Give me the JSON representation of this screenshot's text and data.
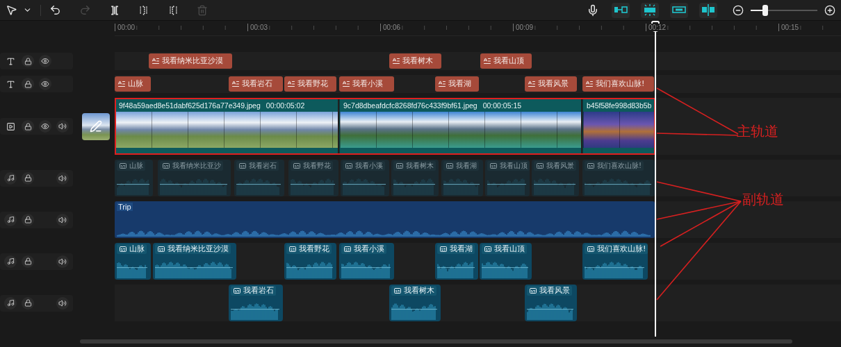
{
  "toolbar": {
    "left_tools": [
      {
        "kind": "select",
        "disabled": false
      },
      {
        "kind": "caret",
        "disabled": false
      },
      {
        "kind": "undo",
        "disabled": false
      },
      {
        "kind": "redo",
        "disabled": true
      },
      {
        "kind": "split",
        "disabled": false
      },
      {
        "kind": "trim_start",
        "disabled": false
      },
      {
        "kind": "trim_end",
        "disabled": false
      },
      {
        "kind": "delete",
        "disabled": true
      }
    ],
    "right_tools": [
      {
        "kind": "mic",
        "disabled": false
      },
      {
        "kind": "snap_link",
        "disabled": false
      },
      {
        "kind": "snap_magnet",
        "disabled": false
      },
      {
        "kind": "link",
        "disabled": false
      },
      {
        "kind": "preview_split",
        "disabled": false
      }
    ],
    "zoom": {
      "level": 0.22
    }
  },
  "ruler": {
    "marks": [
      "00:00",
      "00:03",
      "00:06",
      "00:09",
      "00:12",
      "00:15"
    ]
  },
  "tracks": [
    {
      "kind": "text",
      "clips": [
        {
          "label": "我看纳米比亚沙漠"
        },
        {
          "label": "我看树木"
        },
        {
          "label": "我看山顶"
        }
      ]
    },
    {
      "kind": "text",
      "clips": [
        {
          "label": "山脉"
        },
        {
          "label": "我看岩石"
        },
        {
          "label": "我看野花"
        },
        {
          "label": "我看小溪"
        },
        {
          "label": "我看湖"
        },
        {
          "label": "我看风景"
        },
        {
          "label": "我们喜欢山脉!"
        }
      ]
    },
    {
      "kind": "video",
      "highlighted": true,
      "clips": [
        {
          "name": "9f48a59aed8e51dabf625d176a77e349.jpeg",
          "duration": "00:00:05:02"
        },
        {
          "name": "9c7d8dbeafdcfc8268fd76c433f9bf61.jpeg",
          "duration": "00:00:05:15"
        },
        {
          "name": "b45f58fe998d83b5b"
        }
      ]
    },
    {
      "kind": "audio",
      "dimmed": true,
      "clips": [
        {
          "label": "山脉"
        },
        {
          "label": "我看纳米比亚沙"
        },
        {
          "label": "我看岩石"
        },
        {
          "label": "我看野花"
        },
        {
          "label": "我看小溪"
        },
        {
          "label": "我看树木"
        },
        {
          "label": "我看湖"
        },
        {
          "label": "我看山顶"
        },
        {
          "label": "我看风景"
        },
        {
          "label": "我们喜欢山脉!"
        }
      ]
    },
    {
      "kind": "music",
      "clips": [
        {
          "label": "Trip"
        }
      ]
    },
    {
      "kind": "audio",
      "dimmed": false,
      "clips": [
        {
          "label": "山脉"
        },
        {
          "label": "我看纳米比亚沙漠"
        },
        {
          "label": "我看野花"
        },
        {
          "label": "我看小溪"
        },
        {
          "label": "我看湖"
        },
        {
          "label": "我看山顶"
        },
        {
          "label": "我们喜欢山脉!"
        }
      ]
    },
    {
      "kind": "audio",
      "dimmed": false,
      "clips": [
        {
          "label": "我看岩石"
        },
        {
          "label": "我看树木"
        },
        {
          "label": "我看风景"
        }
      ]
    }
  ],
  "annotations": [
    {
      "label": "主轨道"
    },
    {
      "label": "副轨道"
    }
  ]
}
